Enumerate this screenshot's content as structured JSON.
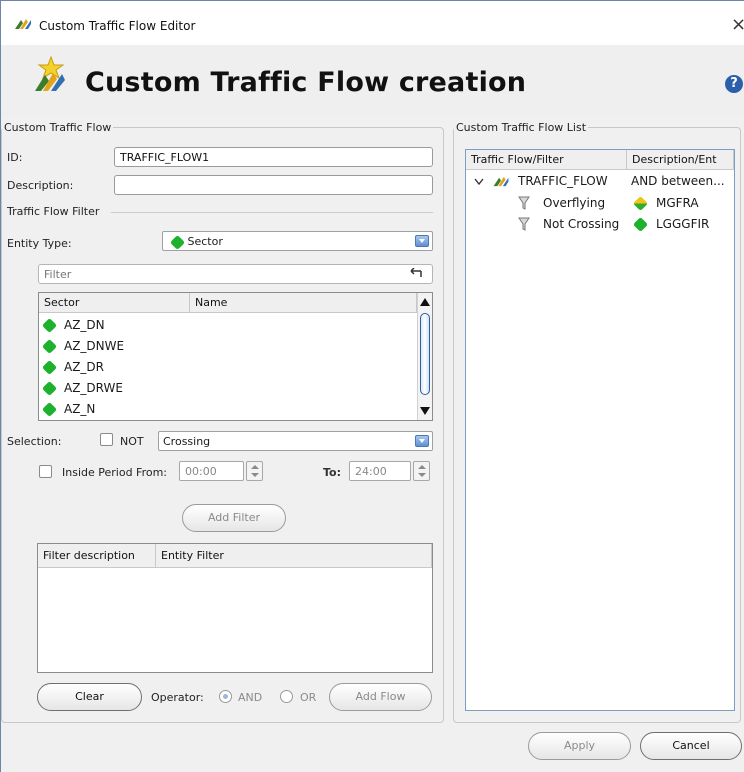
{
  "window": {
    "title": "Custom Traffic Flow Editor",
    "close_glyph": "×",
    "heading": "Custom Traffic Flow creation",
    "help_glyph": "?"
  },
  "custom_flow": {
    "legend": "Custom Traffic Flow",
    "id_label": "ID:",
    "id_value": "TRAFFIC_FLOW1",
    "description_label": "Description:",
    "description_value": ""
  },
  "filter_section": {
    "legend": "Traffic Flow Filter",
    "entity_type_label": "Entity Type:",
    "entity_type_value": "Sector",
    "filter_placeholder": "Filter",
    "table_columns": [
      "Sector",
      "Name"
    ],
    "sectors": [
      {
        "sector": "AZ_DN",
        "name": ""
      },
      {
        "sector": "AZ_DNWE",
        "name": ""
      },
      {
        "sector": "AZ_DR",
        "name": ""
      },
      {
        "sector": "AZ_DRWE",
        "name": ""
      },
      {
        "sector": "AZ_N",
        "name": ""
      }
    ],
    "selection_label": "Selection:",
    "not_label": "NOT",
    "selection_value": "Crossing",
    "inside_period_label": "Inside Period From:",
    "from_value": "00:00",
    "to_label": "To:",
    "to_value": "24:00",
    "add_filter_label": "Add Filter",
    "filters_columns": [
      "Filter description",
      "Entity Filter"
    ],
    "clear_label": "Clear",
    "operator_label": "Operator:",
    "operator_and": "AND",
    "operator_or": "OR",
    "operator_selected": "AND",
    "add_flow_label": "Add Flow"
  },
  "flow_list": {
    "legend": "Custom Traffic Flow List",
    "columns": [
      "Traffic Flow/Filter",
      "Description/Ent"
    ],
    "tree": [
      {
        "label": "TRAFFIC_FLOW",
        "description": "AND between...",
        "level": 0,
        "icon": "traffic-flow-icon",
        "expanded": true
      },
      {
        "label": "Overflying",
        "description": "MGFRA",
        "level": 1,
        "icon": "filter-funnel-icon",
        "entity_icon": "yellow-green-hex-icon"
      },
      {
        "label": "Not Crossing",
        "description": "LGGGFIR",
        "level": 1,
        "icon": "filter-funnel-icon",
        "entity_icon": "green-hex-icon"
      }
    ]
  },
  "footer": {
    "apply_label": "Apply",
    "cancel_label": "Cancel"
  },
  "colors": {
    "sector_green": "#1eb12e",
    "help_blue": "#2c5fa9",
    "window_bg": "#f0f0f0"
  }
}
